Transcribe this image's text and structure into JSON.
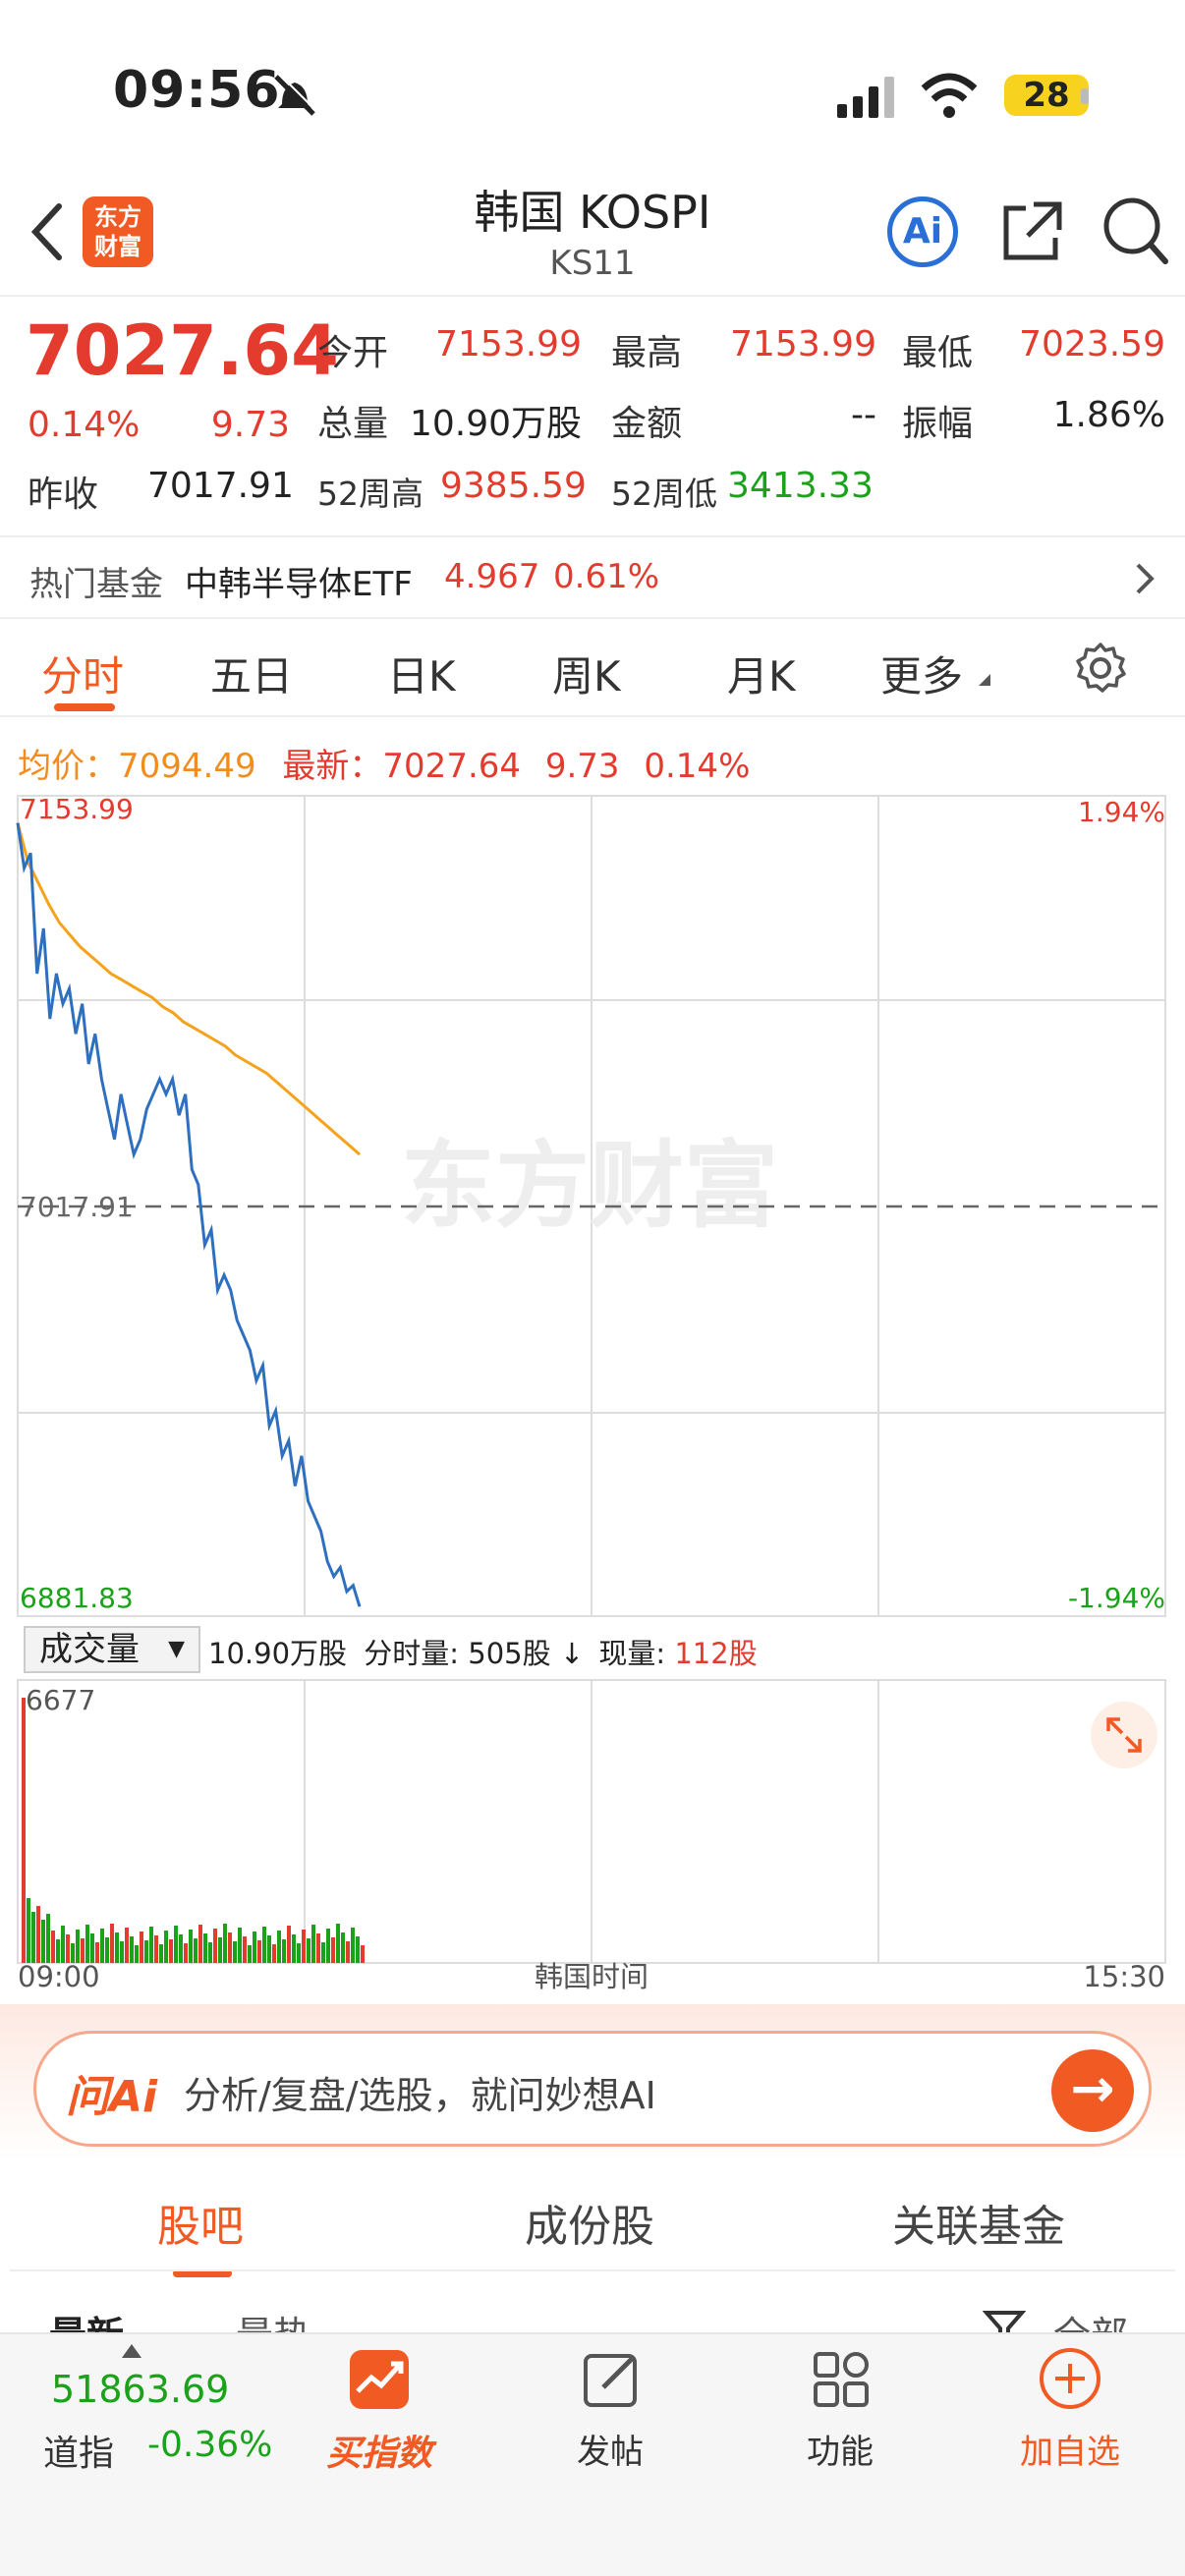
{
  "status": {
    "time": "09:56",
    "battery": "28"
  },
  "header": {
    "title": "韩国 KOSPI",
    "code": "KS11",
    "logo_text_1": "东方",
    "logo_text_2": "财富",
    "ai_label": "Ai"
  },
  "quote": {
    "price": "7027.64",
    "change_pct": "0.14%",
    "change_val": "9.73",
    "prev_close_label": "昨收",
    "prev_close": "7017.91",
    "open_label": "今开",
    "open": "7153.99",
    "high_label": "最高",
    "high": "7153.99",
    "low_label": "最低",
    "low": "7023.59",
    "volume_label": "总量",
    "volume": "10.90万股",
    "amount_label": "金额",
    "amount": "--",
    "amplitude_label": "振幅",
    "amplitude": "1.86%",
    "wk52_high_label": "52周高",
    "wk52_high": "9385.59",
    "wk52_low_label": "52周低",
    "wk52_low": "3413.33"
  },
  "hot_fund": {
    "label": "热门基金",
    "name": "中韩半导体ETF",
    "price": "4.967",
    "pct": "0.61%"
  },
  "tabs": [
    "分时",
    "五日",
    "日K",
    "周K",
    "月K",
    "更多"
  ],
  "avg": {
    "avg_label": "均价：",
    "avg_value": "7094.49",
    "latest_label": "最新：",
    "latest_value": "7027.64",
    "latest_change": "9.73",
    "latest_pct": "0.14%"
  },
  "chart_data": {
    "type": "line",
    "y_top": "7153.99",
    "y_mid": "7017.91",
    "y_bottom": "6881.83",
    "pct_top": "1.94%",
    "pct_bottom": "-1.94%",
    "ylim": [
      6881.83,
      7153.99
    ],
    "watermark": "东方财富",
    "x_start": "09:00",
    "x_mid": "韩国时间",
    "x_end": "15:30",
    "series": [
      {
        "values": [
          7145,
          7130,
          7135,
          7095,
          7110,
          7080,
          7095,
          7085,
          7090,
          7075,
          7085,
          7065,
          7075,
          7060,
          7050,
          7040,
          7055,
          7045,
          7035,
          7040,
          7050,
          7055,
          7060,
          7055,
          7060,
          7048,
          7055,
          7030,
          7025,
          7005,
          7010,
          6990,
          6995,
          6990,
          6980,
          6975,
          6970,
          6960,
          6965,
          6945,
          6950,
          6935,
          6940,
          6925,
          6935,
          6920,
          6915,
          6910,
          6900,
          6895,
          6898,
          6890,
          6892,
          6885
        ]
      },
      {
        "values": [
          7145,
          7132,
          7125,
          7118,
          7112,
          7108,
          7104,
          7101,
          7098,
          7095,
          7093,
          7091,
          7089,
          7087,
          7084,
          7082,
          7079,
          7077,
          7075,
          7073,
          7071,
          7068,
          7066,
          7064,
          7062,
          7059,
          7056,
          7053,
          7050,
          7047,
          7044,
          7041,
          7038,
          7035
        ]
      }
    ]
  },
  "volume": {
    "selector": "成交量",
    "total": "10.90万股",
    "period_label": "分时量:",
    "period": "505股",
    "now_label": "现量:",
    "now": "112股",
    "max": "6677"
  },
  "ai_bar": {
    "placeholder": "分析/复盘/选股，就问妙想AI",
    "brand": "问Ai"
  },
  "bottom_tabs": [
    "股吧",
    "成份股",
    "关联基金"
  ],
  "sub_tabs": [
    "最新",
    "最热",
    "全部"
  ],
  "nav": {
    "index_value": "51863.69",
    "index_name": "道指",
    "index_pct": "-0.36%",
    "buy_index": "买指数",
    "post": "发帖",
    "functions": "功能",
    "add_watch": "加自选"
  }
}
